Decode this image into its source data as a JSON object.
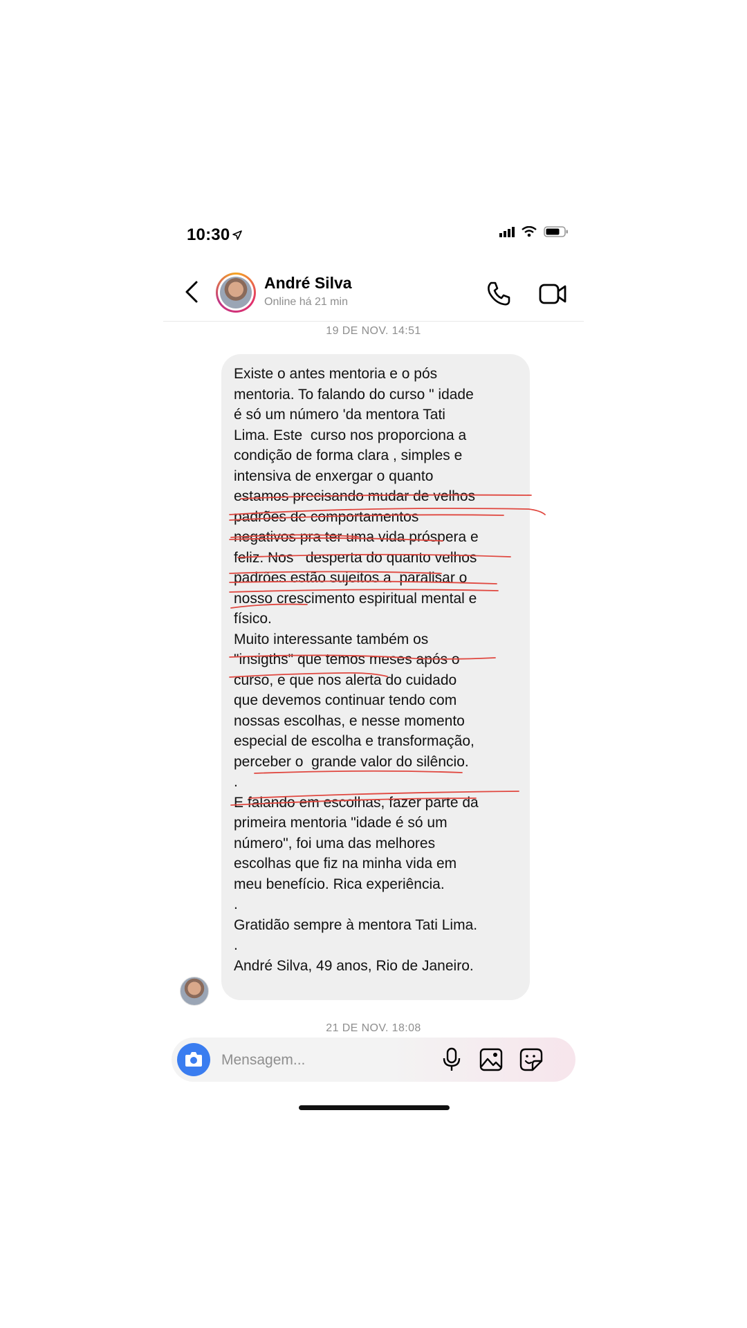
{
  "status_bar": {
    "time": "10:30",
    "location_icon": "location-arrow-icon",
    "icons": [
      "signal-icon",
      "wifi-icon",
      "battery-icon"
    ]
  },
  "header": {
    "name": "André Silva",
    "status": "Online há 21 min",
    "icons": {
      "back": "chevron-left-icon",
      "call": "phone-icon",
      "video": "video-camera-icon"
    }
  },
  "thread": {
    "date_1": "19 DE NOV. 14:51",
    "date_2": "21 DE NOV. 18:08",
    "message_lines": [
      "Existe o antes mentoria e o pós",
      "mentoria. To falando do curso \" idade",
      "é só um número 'da mentora Tati",
      "Lima. Este  curso nos proporciona a",
      "condição de forma clara , simples e",
      "intensiva de enxergar o quanto",
      "estamos precisando mudar de velhos",
      "padrões de comportamentos",
      "negativos pra ter uma vida próspera e",
      "feliz. Nos   desperta do quanto velhos",
      "padrões estão sujeitos a  paralisar o",
      "nosso crescimento espiritual mental e",
      "físico.",
      "Muito interessante também os",
      "\"insigths\" que temos meses após o",
      "curso, e que nos alerta do cuidado",
      "que devemos continuar tendo com",
      "nossas escolhas, e nesse momento",
      "especial de escolha e transformação,",
      "perceber o  grande valor do silêncio.",
      ".",
      "E falando em escolhas, fazer parte da",
      "primeira mentoria \"idade é só um",
      "número\", foi uma das melhores",
      "escolhas que fiz na minha vida em",
      "meu benefício. Rica experiência.",
      ".",
      "Gratidão sempre à mentora Tati Lima.",
      ".",
      "André Silva, 49 anos, Rio de Janeiro."
    ],
    "annotation_color": "#e0473f"
  },
  "composer": {
    "placeholder": "Mensagem...",
    "icons": {
      "camera": "camera-icon",
      "mic": "microphone-icon",
      "gallery": "image-icon",
      "sticker": "sticker-icon"
    },
    "camera_color": "#3a7df0"
  }
}
